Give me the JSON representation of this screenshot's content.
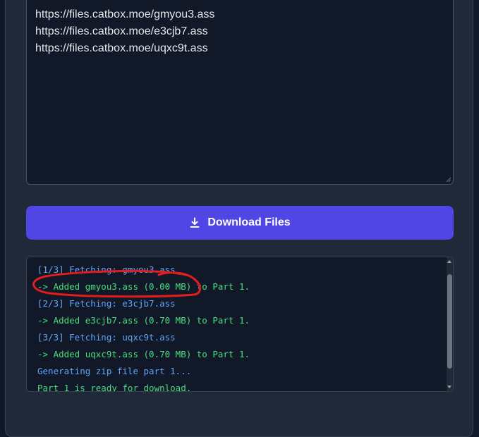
{
  "urls": {
    "lines": [
      "https://files.catbox.moe/gmyou3.ass",
      "https://files.catbox.moe/e3cjb7.ass",
      "https://files.catbox.moe/uqxc9t.ass"
    ]
  },
  "download_button": {
    "label": "Download Files",
    "icon": "download-icon"
  },
  "log": {
    "lines": [
      "[1/3] Fetching: gmyou3.ass",
      "-> Added gmyou3.ass (0.00 MB) to Part 1.",
      "[2/3] Fetching: e3cjb7.ass",
      "-> Added e3cjb7.ass (0.70 MB) to Part 1.",
      "[3/3] Fetching: uqxc9t.ass",
      "-> Added uqxc9t.ass (0.70 MB) to Part 1.",
      "Generating zip file part 1...",
      "Part 1 is ready for download."
    ]
  },
  "colors": {
    "background": "#111827",
    "card": "#1f2937",
    "accent": "#4f46e5",
    "log_info": "#60a5fa",
    "log_success": "#4ade80",
    "annotation": "#e11d1d"
  }
}
